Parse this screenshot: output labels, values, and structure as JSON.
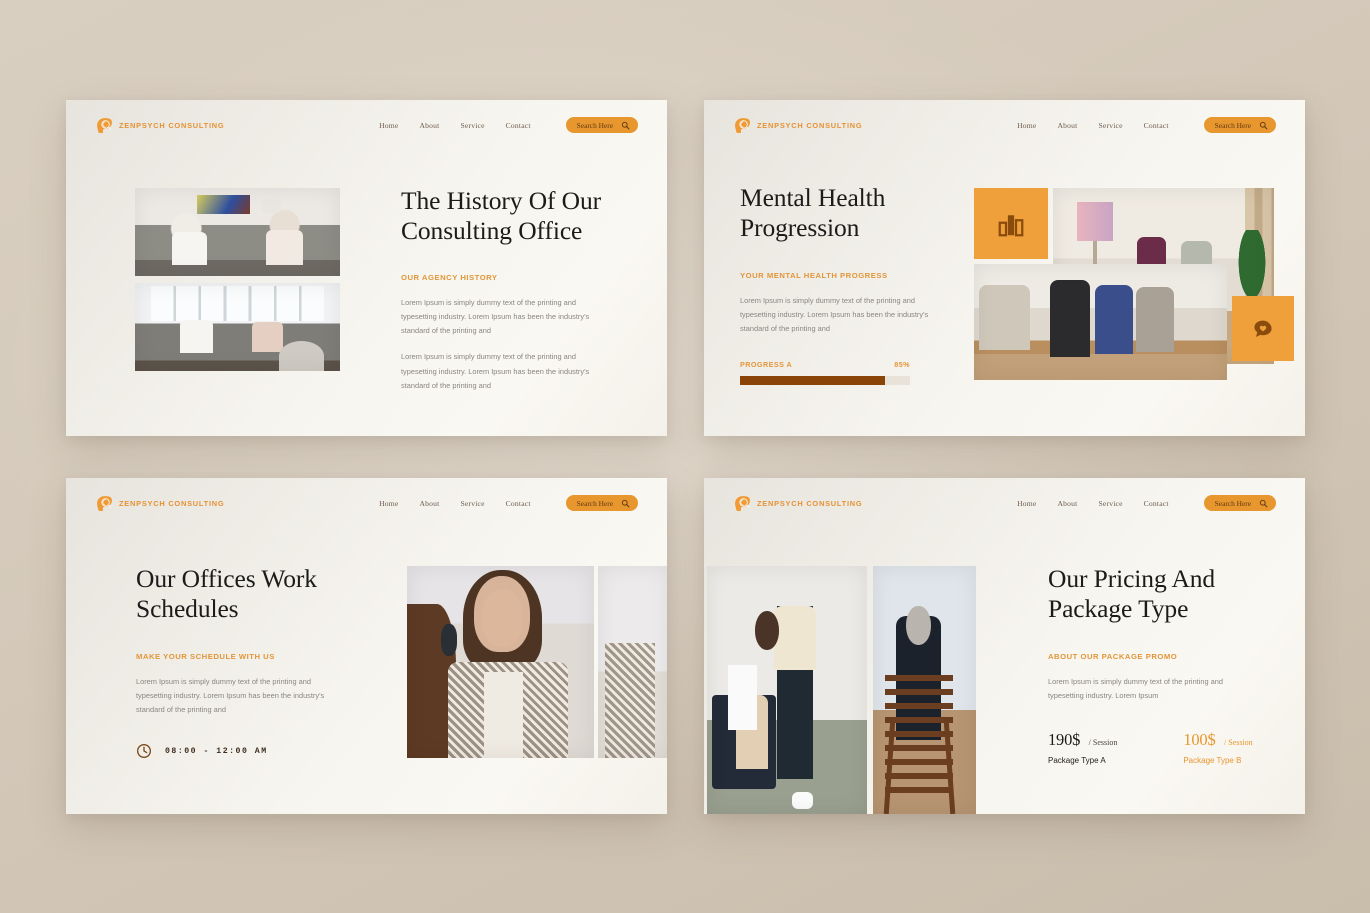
{
  "background_color": "#d7ccbd",
  "accent_orange": "#e8962e",
  "tile_orange": "#f0a03a",
  "progress_fill_color": "#8a4408",
  "brand": {
    "name": "ZENPSYCH CONSULTING",
    "logo_icon": "head-brain-icon"
  },
  "nav": {
    "items": [
      {
        "label": "Home"
      },
      {
        "label": "About"
      },
      {
        "label": "Service"
      },
      {
        "label": "Contact"
      }
    ],
    "search_label": "Search Here",
    "search_icon": "search-icon"
  },
  "slides": [
    {
      "id": "history",
      "title": "The History Of Our Consulting Office",
      "eyebrow": "OUR AGENCY HISTORY",
      "paragraphs": [
        "Lorem Ipsum is simply dummy text of the printing and typesetting industry. Lorem Ipsum has been the industry's standard of the printing and",
        "Lorem Ipsum is simply dummy text of the printing and typesetting industry. Lorem Ipsum has been the industry's standard of the printing and"
      ],
      "images": [
        {
          "name": "photo-couple-on-sofa"
        },
        {
          "name": "photo-group-session-windows"
        }
      ]
    },
    {
      "id": "progression",
      "title": "Mental Health Progression",
      "eyebrow": "YOUR MENTAL HEALTH PROGRESS",
      "paragraphs": [
        "Lorem Ipsum is simply dummy text of the printing and typesetting industry. Lorem Ipsum has been the industry's standard of the printing and"
      ],
      "progress": {
        "label": "PROGRESS A",
        "percent_label": "85%",
        "percent_value": 85
      },
      "tiles": [
        {
          "name": "bar-chart-icon-tile"
        },
        {
          "name": "photo-therapy-conversation"
        },
        {
          "name": "photo-group-therapy-circle"
        },
        {
          "name": "chat-heart-icon-tile"
        }
      ]
    },
    {
      "id": "schedules",
      "title": "Our Offices Work Schedules",
      "eyebrow": "MAKE YOUR SCHEDULE WITH US",
      "paragraphs": [
        "Lorem Ipsum is simply dummy text of the printing and typesetting industry. Lorem Ipsum has been the industry's standard of the printing and"
      ],
      "hours": {
        "icon": "clock-icon",
        "text": "08:00 - 12:00 AM"
      },
      "images": [
        {
          "name": "photo-counselling-session"
        },
        {
          "name": "photo-counselling-side"
        }
      ]
    },
    {
      "id": "pricing",
      "title": "Our Pricing And Package Type",
      "eyebrow": "ABOUT OUR PACKAGE PROMO",
      "paragraphs": [
        "Lorem Ipsum is simply dummy text of the printing and typesetting industry. Lorem Ipsum"
      ],
      "packages": [
        {
          "amount": "190$",
          "per": "/ Session",
          "name": "Package Type A"
        },
        {
          "amount": "100$",
          "per": "/ Session",
          "name": "Package Type B"
        }
      ],
      "images": [
        {
          "name": "photo-child-therapy"
        },
        {
          "name": "photo-seated-patient-back"
        }
      ]
    }
  ]
}
